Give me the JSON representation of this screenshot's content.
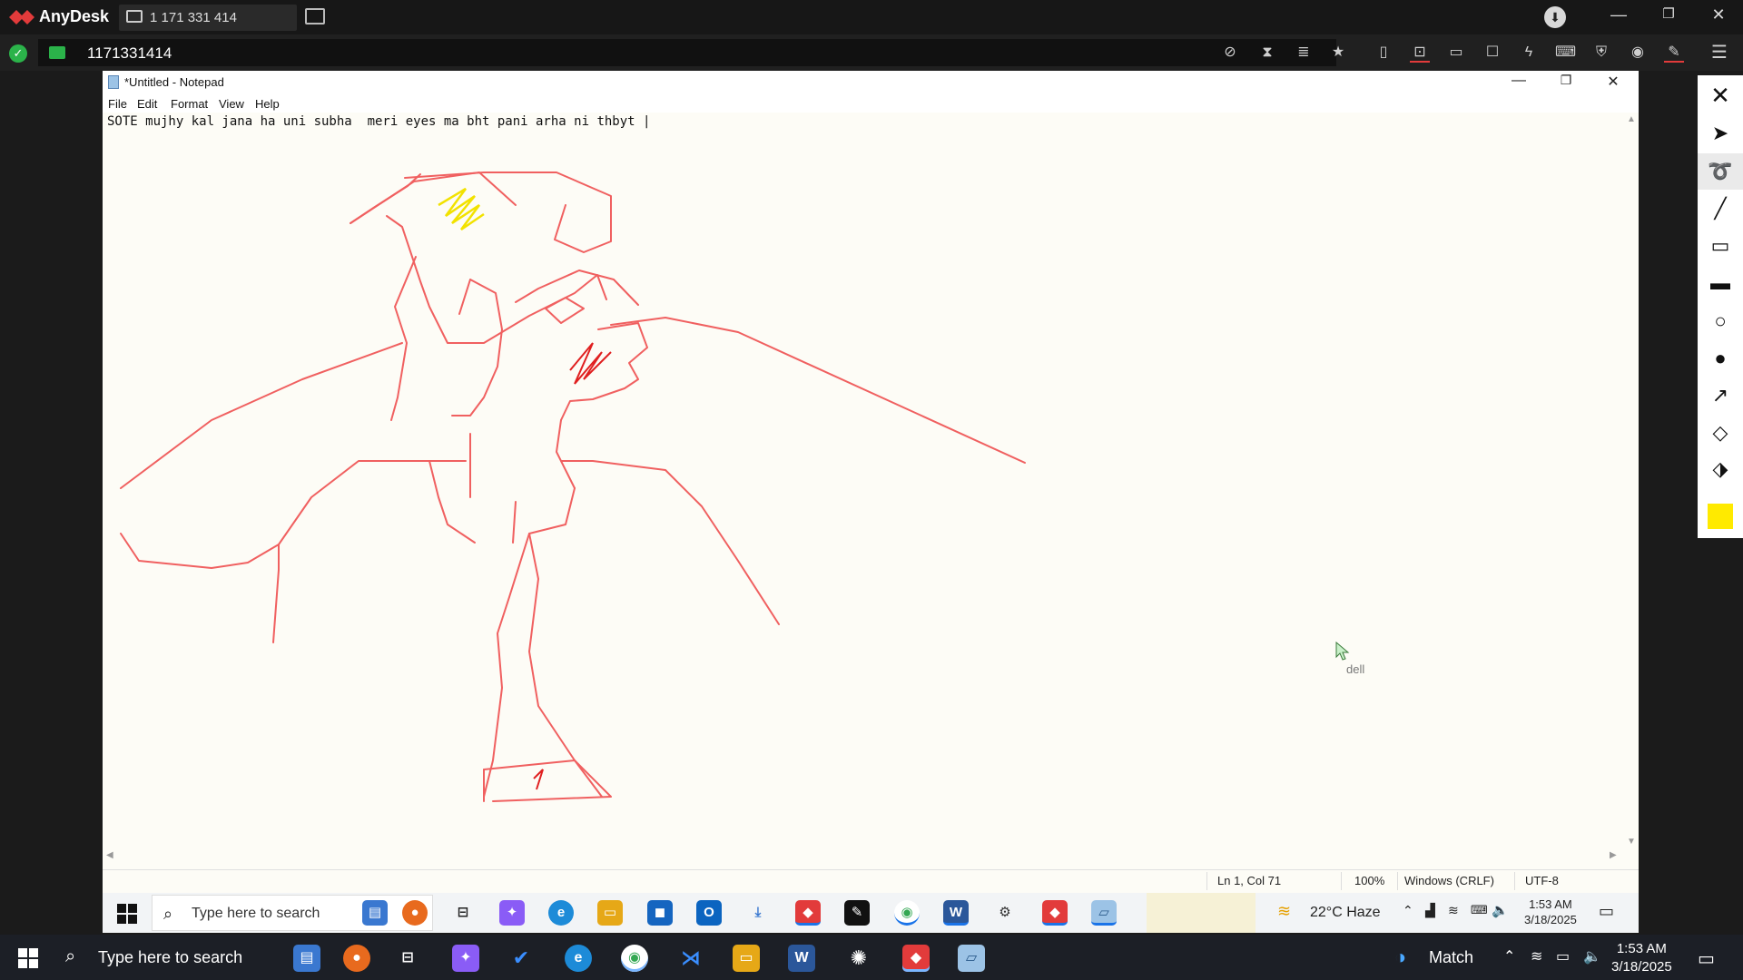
{
  "anydesk": {
    "app_name": "AnyDesk",
    "tab_label": "1 171 331 414",
    "address": "1171331414",
    "accent": "#e23b3b"
  },
  "notepad": {
    "title": "*Untitled - Notepad",
    "menu": [
      "File",
      "Edit",
      "Format",
      "View",
      "Help"
    ],
    "text": "SOTE mujhy kal jana ha uni subha  meri eyes ma bht pani arha ni thbyt |",
    "status": {
      "position": "Ln 1, Col 71",
      "zoom": "100%",
      "line_ending": "Windows (CRLF)",
      "encoding": "UTF-8"
    }
  },
  "remote_cursor_label": "dell",
  "inner_taskbar": {
    "search_placeholder": "Type here to search",
    "weather": "22°C  Haze",
    "time": "1:53 AM",
    "date": "3/18/2025"
  },
  "outer_taskbar": {
    "search_placeholder": "Type here to search",
    "widget": "Match",
    "time": "1:53 AM",
    "date": "3/18/2025"
  },
  "draw_tools": [
    "close",
    "pointer",
    "freehand",
    "line",
    "rectangle",
    "filled-rectangle",
    "circle",
    "filled-circle",
    "arrow",
    "eraser",
    "clear",
    "color"
  ],
  "pen_color": "#ffea00",
  "drawing_color": "#f06060"
}
